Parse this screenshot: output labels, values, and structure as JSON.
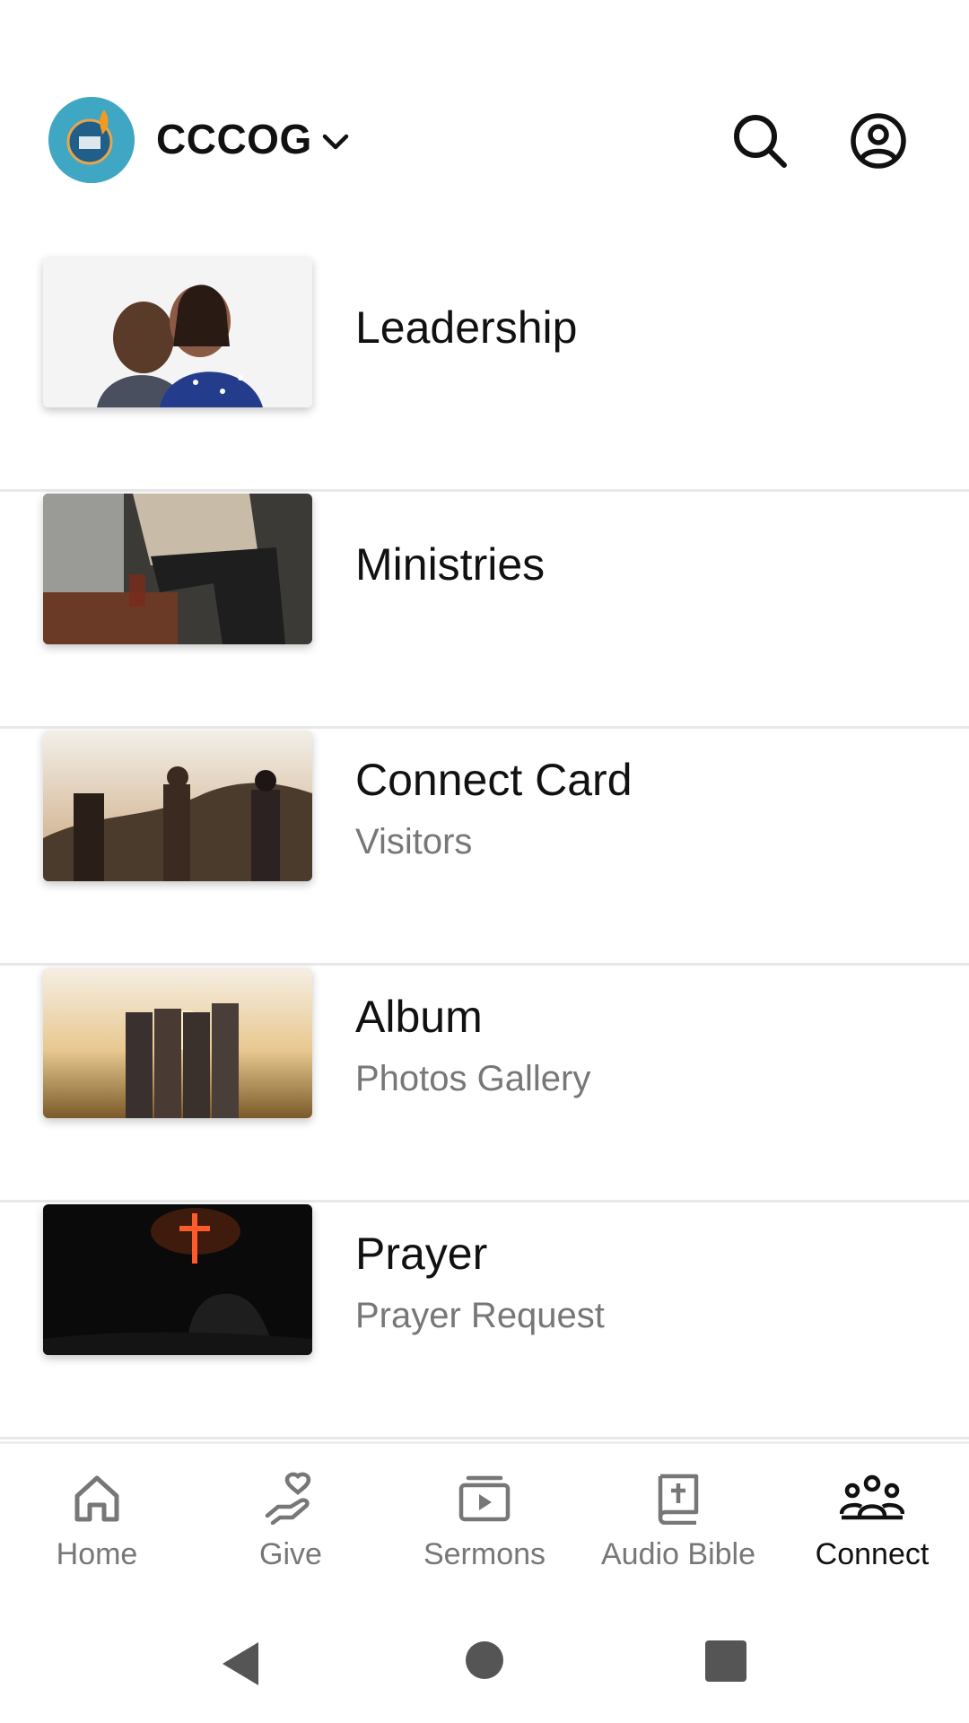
{
  "header": {
    "church_name": "CCCOG",
    "logo_text": "CCCOG",
    "avatar_color": "#3fa7c4"
  },
  "list": [
    {
      "title": "Leadership",
      "subtitle": ""
    },
    {
      "title": "Ministries",
      "subtitle": ""
    },
    {
      "title": "Connect Card",
      "subtitle": "Visitors"
    },
    {
      "title": "Album",
      "subtitle": "Photos Gallery"
    },
    {
      "title": "Prayer",
      "subtitle": "Prayer Request"
    }
  ],
  "nav": {
    "items": [
      {
        "label": "Home",
        "icon": "home-icon"
      },
      {
        "label": "Give",
        "icon": "give-icon"
      },
      {
        "label": "Sermons",
        "icon": "sermons-icon"
      },
      {
        "label": "Audio Bible",
        "icon": "bible-icon"
      },
      {
        "label": "Connect",
        "icon": "connect-icon"
      }
    ],
    "active": "Connect"
  },
  "colors": {
    "text_primary": "#111111",
    "text_secondary": "#777777",
    "divider": "#e8e8e8"
  }
}
